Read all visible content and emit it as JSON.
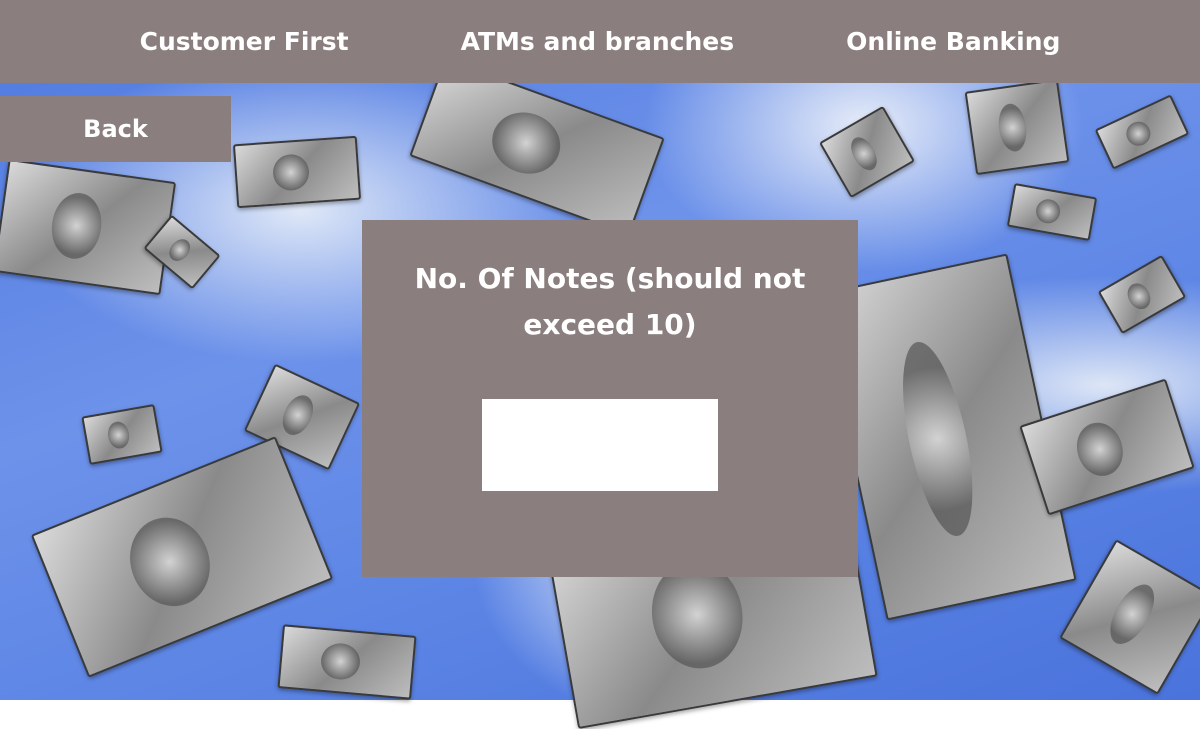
{
  "nav": {
    "links": [
      {
        "label": "Customer First"
      },
      {
        "label": "ATMs and branches"
      },
      {
        "label": "Online Banking"
      }
    ]
  },
  "back_button": {
    "label": "Back"
  },
  "notes_form": {
    "label": "No. Of Notes (should not exceed 10)",
    "input_value": "",
    "input_placeholder": ""
  },
  "colors": {
    "bar": "#8a7f7e",
    "text": "#ffffff",
    "input": "#ffffff"
  }
}
